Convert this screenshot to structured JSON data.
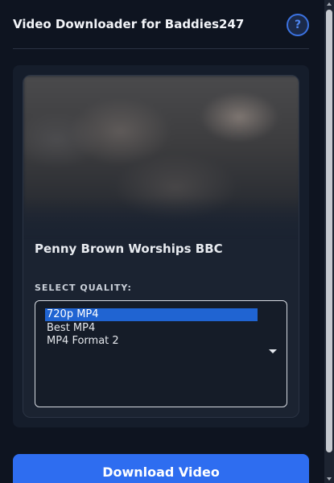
{
  "header": {
    "title": "Video Downloader for Baddies247",
    "help_icon": "question-mark-icon",
    "help_label": "?"
  },
  "video": {
    "title": "Penny Brown Worships BBC"
  },
  "quality": {
    "label": "SELECT QUALITY:",
    "options": [
      "720p MP4",
      "Best MP4",
      "MP4 Format 2"
    ],
    "selected_index": 0
  },
  "actions": {
    "download_label": "Download Video"
  },
  "colors": {
    "accent": "#2e6df0",
    "selected_option": "#2064d2",
    "background": "#0e1420"
  }
}
